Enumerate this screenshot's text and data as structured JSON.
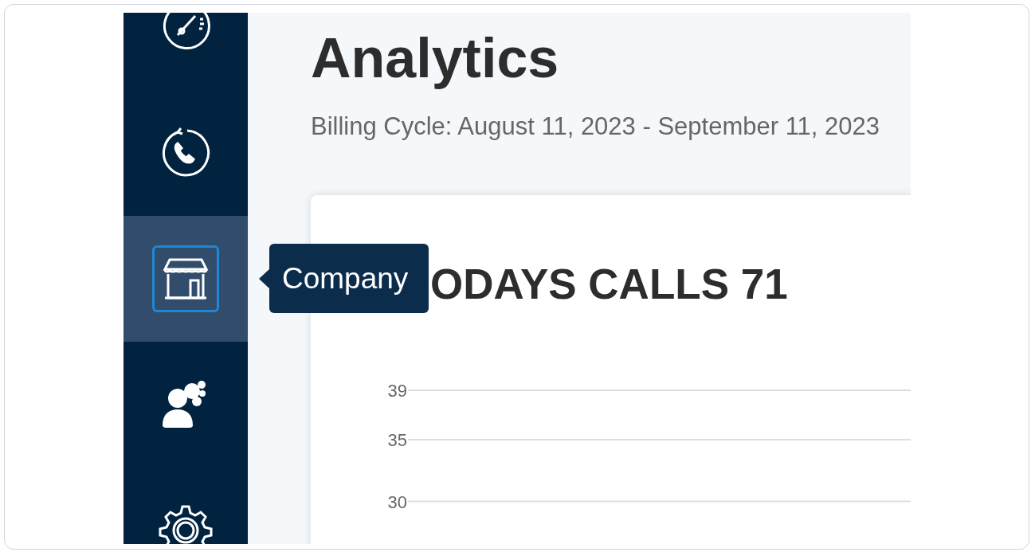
{
  "sidebar": {
    "items": [
      {
        "kind": "gauge",
        "selected": false
      },
      {
        "kind": "phone",
        "selected": false
      },
      {
        "kind": "store",
        "selected": true
      },
      {
        "kind": "users",
        "selected": false
      },
      {
        "kind": "gear",
        "selected": false
      }
    ],
    "tooltip": "Company"
  },
  "page": {
    "title": "Analytics",
    "subtitle": "Billing Cycle: August 11, 2023 - September 11, 2023"
  },
  "card": {
    "title": "ODAYS CALLS 71",
    "y_axis_labels": [
      "39",
      "35",
      "30"
    ]
  }
}
